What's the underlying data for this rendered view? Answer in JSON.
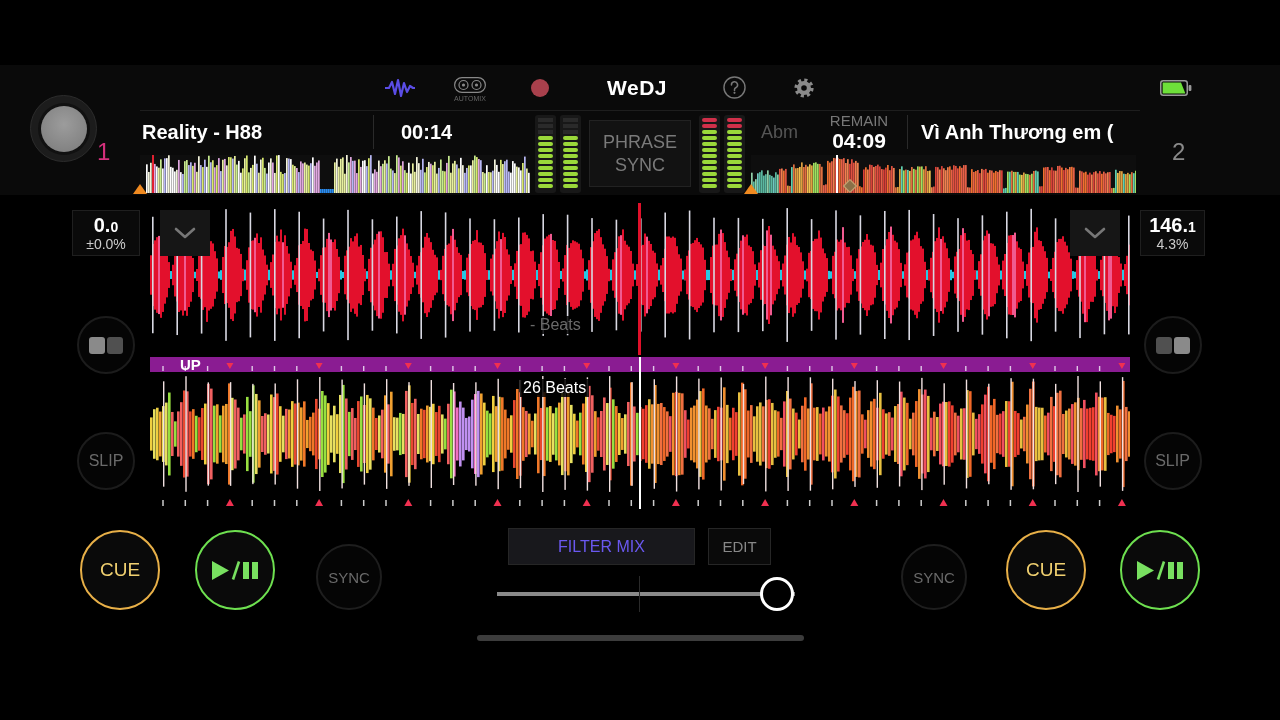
{
  "toolbar": {
    "automix_label": "AUTOMIX",
    "logo": "WeDJ"
  },
  "decks": [
    {
      "number": "1",
      "active": true,
      "title": "Reality - H88",
      "time": "00:14",
      "overview": {
        "level": 0.03
      },
      "meters": [
        {
          "level": 0.75
        },
        {
          "level": 0.75
        }
      ],
      "bpm": "0.",
      "bpm_fraction": "0",
      "pitch": "±0.0%",
      "beats": {
        "text": "- Beats",
        "dimmed": true
      },
      "slip": "SLIP",
      "cue": "CUE",
      "sync": "SYNC"
    },
    {
      "number": "2",
      "active": false,
      "key": "Abm",
      "time_label": "REMAIN",
      "time": "04:09",
      "title": "Vì Anh Thương em (",
      "overview": {
        "level": 0.22
      },
      "meters": [
        {
          "level": 1
        },
        {
          "level": 1
        }
      ],
      "bpm": "146.",
      "bpm_fraction": "1",
      "pitch": "4.3%",
      "beats": {
        "text": "26 Beats",
        "dimmed": false
      },
      "slip": "SLIP",
      "cue": "CUE",
      "sync": "SYNC"
    }
  ],
  "phrase_sync": "PHRASE SYNC",
  "phrase_bar": {
    "label": "UP"
  },
  "mixer": {
    "mode": "FILTER MIX",
    "edit": "EDIT",
    "crossfader": {
      "level": 0.94
    }
  }
}
